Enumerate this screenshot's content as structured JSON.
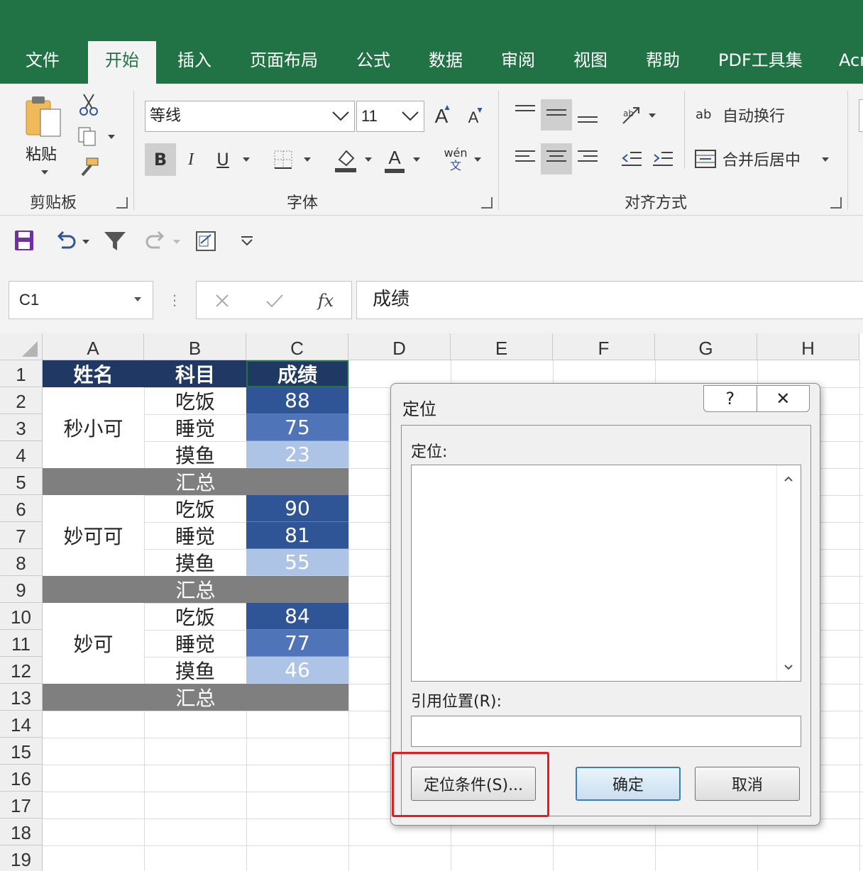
{
  "colors": {
    "ribbon_green": "#217346",
    "header_fill": "#203864",
    "summary_fill": "#7f7f7f",
    "score_high": "#2f5597",
    "score_mid": "#4f74b8",
    "score_low": "#adc4e6",
    "highlight_red": "#e02020"
  },
  "tabs": [
    "文件",
    "开始",
    "插入",
    "页面布局",
    "公式",
    "数据",
    "审阅",
    "视图",
    "帮助",
    "PDF工具集",
    "Acr"
  ],
  "active_tab": "开始",
  "ribbon": {
    "clipboard": {
      "paste_label": "粘贴",
      "group_label": "剪贴板",
      "icons": [
        "paste-icon",
        "cut-icon",
        "copy-icon",
        "format-painter-icon"
      ]
    },
    "font": {
      "font_name": "等线",
      "font_size": "11",
      "grow": "A",
      "shrink": "A",
      "bold": "B",
      "italic": "I",
      "underline": "U",
      "font_color": "A",
      "phonetic": "wén",
      "phonetic_sub": "文",
      "group_label": "字体"
    },
    "alignment": {
      "wrap_text": "自动换行",
      "wrap_icon_text": "ab",
      "merge_center": "合并后居中",
      "group_label": "对齐方式"
    }
  },
  "qat_icons": [
    "save-icon",
    "undo-icon",
    "filter-icon",
    "redo-icon",
    "quick-print-icon",
    "customize-icon"
  ],
  "formula_bar": {
    "name_box": "C1",
    "fx": "fx",
    "formula": "成绩"
  },
  "sheet": {
    "columns": [
      "A",
      "B",
      "C",
      "D",
      "E",
      "F",
      "G",
      "H"
    ],
    "rows": [
      "1",
      "2",
      "3",
      "4",
      "5",
      "6",
      "7",
      "8",
      "9",
      "10",
      "11",
      "12",
      "13",
      "14",
      "15",
      "16",
      "17",
      "18",
      "19"
    ],
    "header": [
      "姓名",
      "科目",
      "成绩"
    ],
    "groups": [
      {
        "name": "秒小可",
        "items": [
          {
            "subject": "吃饭",
            "score": "88"
          },
          {
            "subject": "睡觉",
            "score": "75"
          },
          {
            "subject": "摸鱼",
            "score": "23"
          }
        ]
      },
      {
        "name": "妙可可",
        "items": [
          {
            "subject": "吃饭",
            "score": "90"
          },
          {
            "subject": "睡觉",
            "score": "81"
          },
          {
            "subject": "摸鱼",
            "score": "55"
          }
        ]
      },
      {
        "name": "妙可",
        "items": [
          {
            "subject": "吃饭",
            "score": "84"
          },
          {
            "subject": "睡觉",
            "score": "77"
          },
          {
            "subject": "摸鱼",
            "score": "46"
          }
        ]
      }
    ],
    "summary_label": "汇总"
  },
  "dialog": {
    "title": "定位",
    "help": "?",
    "close": "✕",
    "goto_label": "定位:",
    "reference_label": "引用位置(R):",
    "special_button": "定位条件(S)...",
    "ok_button": "确定",
    "cancel_button": "取消"
  }
}
